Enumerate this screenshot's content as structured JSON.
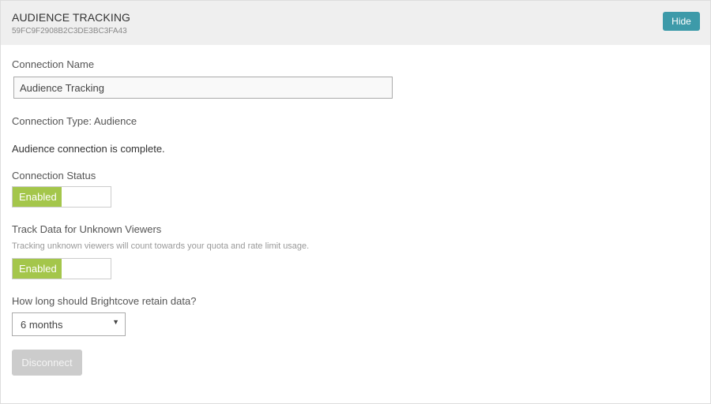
{
  "header": {
    "title": "AUDIENCE TRACKING",
    "id": "59FC9F2908B2C3DE3BC3FA43",
    "hide_label": "Hide"
  },
  "connection_name": {
    "label": "Connection Name",
    "value": "Audience Tracking"
  },
  "connection_type": "Connection Type: Audience",
  "connection_message": "Audience connection is complete.",
  "connection_status": {
    "label": "Connection Status",
    "state_label": "Enabled"
  },
  "track_unknown": {
    "label": "Track Data for Unknown Viewers",
    "note": "Tracking unknown viewers will count towards your quota and rate limit usage.",
    "state_label": "Enabled"
  },
  "retention": {
    "label": "How long should Brightcove retain data?",
    "selected": "6 months"
  },
  "disconnect_label": "Disconnect",
  "colors": {
    "header_bg": "#efefef",
    "hide_button": "#3d9aa9",
    "toggle_on": "#a4c64b",
    "disconnect_disabled": "#cccccc"
  },
  "icons": {
    "select_arrow": "caret-down-icon"
  }
}
